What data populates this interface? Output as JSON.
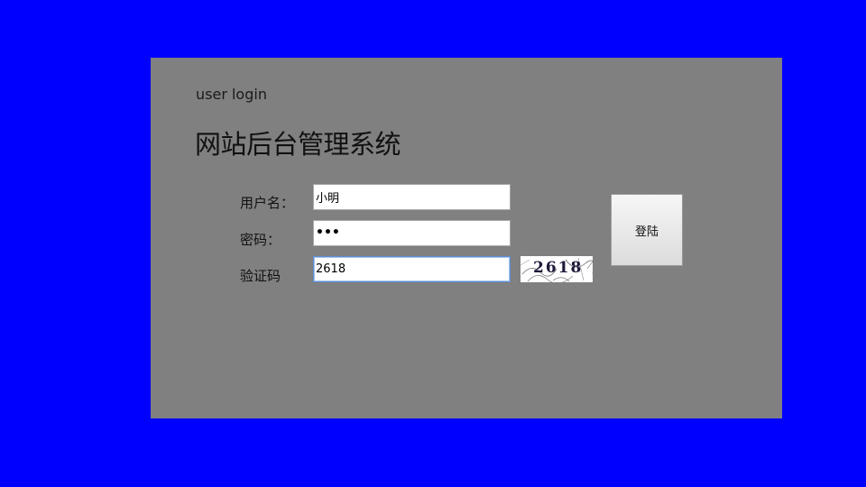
{
  "login": {
    "subtitle": "user login",
    "title": "网站后台管理系统",
    "username_label": "用户名：",
    "username_value": "小明",
    "password_label": "密码：",
    "password_mask": "•••",
    "captcha_label": "验证码",
    "captcha_value": "2618",
    "captcha_image_text": "2618",
    "submit_label": "登陆"
  },
  "colors": {
    "background": "#0000ff",
    "panel": "#808080",
    "focus_border": "#5b8fd6"
  }
}
